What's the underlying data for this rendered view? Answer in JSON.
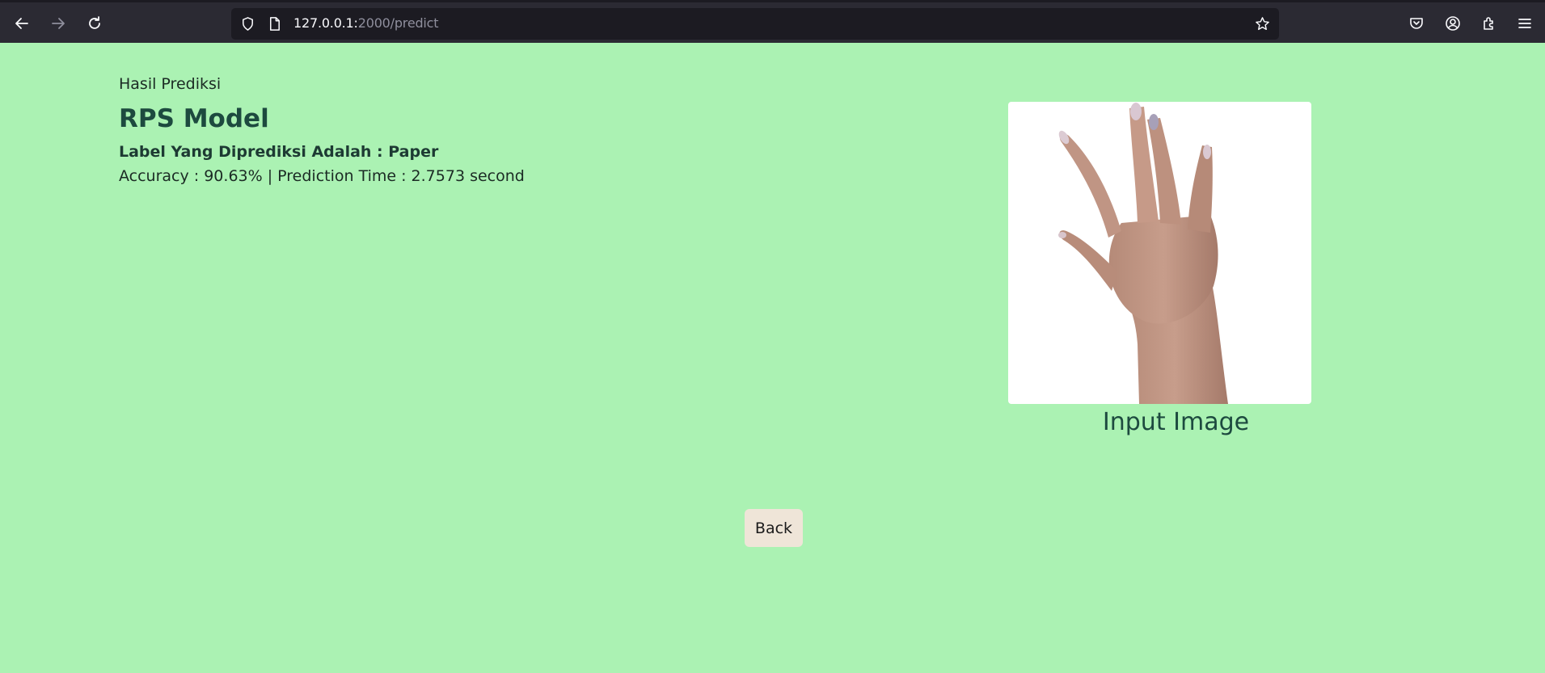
{
  "browser": {
    "url_host": "127.0.0.1:",
    "url_path": "2000/predict",
    "icons": [
      "back-arrow-icon",
      "forward-arrow-icon",
      "reload-icon",
      "shield-icon",
      "page-icon",
      "bookmark-star-icon",
      "pocket-icon",
      "account-icon",
      "extensions-icon",
      "menu-icon"
    ]
  },
  "page": {
    "subtitle": "Hasil Prediksi",
    "title": "RPS Model",
    "label_line": "Label Yang Diprediksi Adalah : Paper",
    "metrics": "Accuracy : 90.63% | Prediction Time : 2.7573 second",
    "image_caption": "Input Image",
    "back_label": "Back"
  },
  "colors": {
    "page_background": "#abf2b3",
    "toolbar": "#2b2a33",
    "urlbar": "#1c1b22",
    "title": "#1d4a3f",
    "back_button": "#efe5d8"
  }
}
